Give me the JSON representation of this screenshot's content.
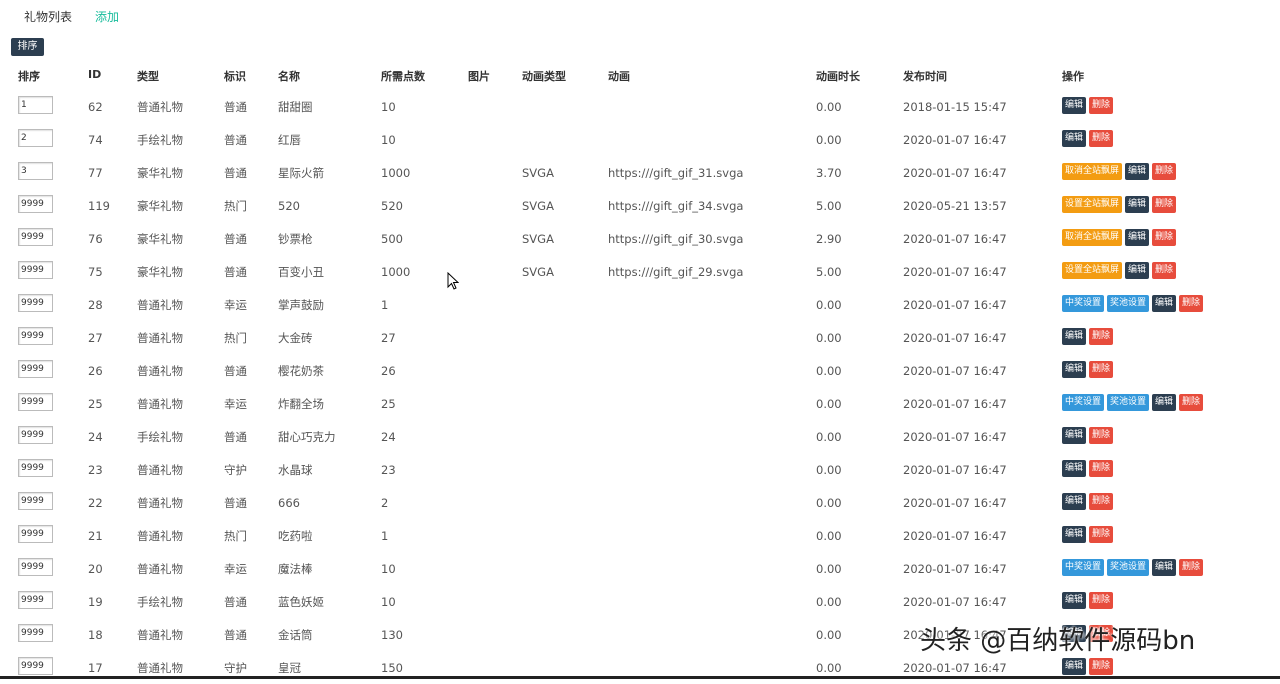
{
  "tabs": {
    "list": "礼物列表",
    "add": "添加"
  },
  "toolbar": {
    "sort_button": "排序"
  },
  "headers": {
    "order": "排序",
    "id": "ID",
    "type": "类型",
    "mark": "标识",
    "name": "名称",
    "points": "所需点数",
    "image": "图片",
    "anim_type": "动画类型",
    "anim": "动画",
    "duration": "动画时长",
    "publish_time": "发布时间",
    "actions": "操作"
  },
  "buttons": {
    "edit": "编辑",
    "delete": "删除",
    "cancel_global": "取消全站飘屏",
    "set_global": "设置全站飘屏",
    "win_setting": "中奖设置",
    "pool_setting": "奖池设置"
  },
  "rows": [
    {
      "order": "1",
      "id": "62",
      "type": "普通礼物",
      "mark": "普通",
      "name": "甜甜圈",
      "points": "10",
      "anim_type": "",
      "anim": "",
      "duration": "0.00",
      "time": "2018-01-15 15:47",
      "actions": [
        "edit",
        "delete"
      ]
    },
    {
      "order": "2",
      "id": "74",
      "type": "手绘礼物",
      "mark": "普通",
      "name": "红唇",
      "points": "10",
      "anim_type": "",
      "anim": "",
      "duration": "0.00",
      "time": "2020-01-07 16:47",
      "actions": [
        "edit",
        "delete"
      ]
    },
    {
      "order": "3",
      "id": "77",
      "type": "豪华礼物",
      "mark": "普通",
      "name": "星际火箭",
      "points": "1000",
      "anim_type": "SVGA",
      "anim": "https:///gift_gif_31.svga",
      "duration": "3.70",
      "time": "2020-01-07 16:47",
      "actions": [
        "cancel_global",
        "edit",
        "delete"
      ]
    },
    {
      "order": "9999",
      "id": "119",
      "type": "豪华礼物",
      "mark": "热门",
      "name": "520",
      "points": "520",
      "anim_type": "SVGA",
      "anim": "https:///gift_gif_34.svga",
      "duration": "5.00",
      "time": "2020-05-21 13:57",
      "actions": [
        "set_global",
        "edit",
        "delete"
      ]
    },
    {
      "order": "9999",
      "id": "76",
      "type": "豪华礼物",
      "mark": "普通",
      "name": "钞票枪",
      "points": "500",
      "anim_type": "SVGA",
      "anim": "https:///gift_gif_30.svga",
      "duration": "2.90",
      "time": "2020-01-07 16:47",
      "actions": [
        "cancel_global",
        "edit",
        "delete"
      ]
    },
    {
      "order": "9999",
      "id": "75",
      "type": "豪华礼物",
      "mark": "普通",
      "name": "百变小丑",
      "points": "1000",
      "anim_type": "SVGA",
      "anim": "https:///gift_gif_29.svga",
      "duration": "5.00",
      "time": "2020-01-07 16:47",
      "actions": [
        "set_global",
        "edit",
        "delete"
      ]
    },
    {
      "order": "9999",
      "id": "28",
      "type": "普通礼物",
      "mark": "幸运",
      "name": "掌声鼓励",
      "points": "1",
      "anim_type": "",
      "anim": "",
      "duration": "0.00",
      "time": "2020-01-07 16:47",
      "actions": [
        "win_setting",
        "pool_setting",
        "edit",
        "delete"
      ]
    },
    {
      "order": "9999",
      "id": "27",
      "type": "普通礼物",
      "mark": "热门",
      "name": "大金砖",
      "points": "27",
      "anim_type": "",
      "anim": "",
      "duration": "0.00",
      "time": "2020-01-07 16:47",
      "actions": [
        "edit",
        "delete"
      ]
    },
    {
      "order": "9999",
      "id": "26",
      "type": "普通礼物",
      "mark": "普通",
      "name": "樱花奶茶",
      "points": "26",
      "anim_type": "",
      "anim": "",
      "duration": "0.00",
      "time": "2020-01-07 16:47",
      "actions": [
        "edit",
        "delete"
      ]
    },
    {
      "order": "9999",
      "id": "25",
      "type": "普通礼物",
      "mark": "幸运",
      "name": "炸翻全场",
      "points": "25",
      "anim_type": "",
      "anim": "",
      "duration": "0.00",
      "time": "2020-01-07 16:47",
      "actions": [
        "win_setting",
        "pool_setting",
        "edit",
        "delete"
      ]
    },
    {
      "order": "9999",
      "id": "24",
      "type": "手绘礼物",
      "mark": "普通",
      "name": "甜心巧克力",
      "points": "24",
      "anim_type": "",
      "anim": "",
      "duration": "0.00",
      "time": "2020-01-07 16:47",
      "actions": [
        "edit",
        "delete"
      ]
    },
    {
      "order": "9999",
      "id": "23",
      "type": "普通礼物",
      "mark": "守护",
      "name": "水晶球",
      "points": "23",
      "anim_type": "",
      "anim": "",
      "duration": "0.00",
      "time": "2020-01-07 16:47",
      "actions": [
        "edit",
        "delete"
      ]
    },
    {
      "order": "9999",
      "id": "22",
      "type": "普通礼物",
      "mark": "普通",
      "name": "666",
      "points": "2",
      "anim_type": "",
      "anim": "",
      "duration": "0.00",
      "time": "2020-01-07 16:47",
      "actions": [
        "edit",
        "delete"
      ]
    },
    {
      "order": "9999",
      "id": "21",
      "type": "普通礼物",
      "mark": "热门",
      "name": "吃药啦",
      "points": "1",
      "anim_type": "",
      "anim": "",
      "duration": "0.00",
      "time": "2020-01-07 16:47",
      "actions": [
        "edit",
        "delete"
      ]
    },
    {
      "order": "9999",
      "id": "20",
      "type": "普通礼物",
      "mark": "幸运",
      "name": "魔法棒",
      "points": "10",
      "anim_type": "",
      "anim": "",
      "duration": "0.00",
      "time": "2020-01-07 16:47",
      "actions": [
        "win_setting",
        "pool_setting",
        "edit",
        "delete"
      ]
    },
    {
      "order": "9999",
      "id": "19",
      "type": "手绘礼物",
      "mark": "普通",
      "name": "蓝色妖姬",
      "points": "10",
      "anim_type": "",
      "anim": "",
      "duration": "0.00",
      "time": "2020-01-07 16:47",
      "actions": [
        "edit",
        "delete"
      ]
    },
    {
      "order": "9999",
      "id": "18",
      "type": "普通礼物",
      "mark": "普通",
      "name": "金话筒",
      "points": "130",
      "anim_type": "",
      "anim": "",
      "duration": "0.00",
      "time": "2020-01-07 16:47",
      "actions": [
        "edit",
        "delete"
      ]
    },
    {
      "order": "9999",
      "id": "17",
      "type": "普通礼物",
      "mark": "守护",
      "name": "皇冠",
      "points": "150",
      "anim_type": "",
      "anim": "",
      "duration": "0.00",
      "time": "2020-01-07 16:47",
      "actions": [
        "edit",
        "delete"
      ]
    }
  ],
  "watermark": "头条 @百纳软件源码bn",
  "colors": {
    "accent_green": "#18bc9c",
    "edit_btn": "#2c3e50",
    "delete_btn": "#e74c3c",
    "global_btn": "#f39c12",
    "setting_btn": "#3498db"
  }
}
